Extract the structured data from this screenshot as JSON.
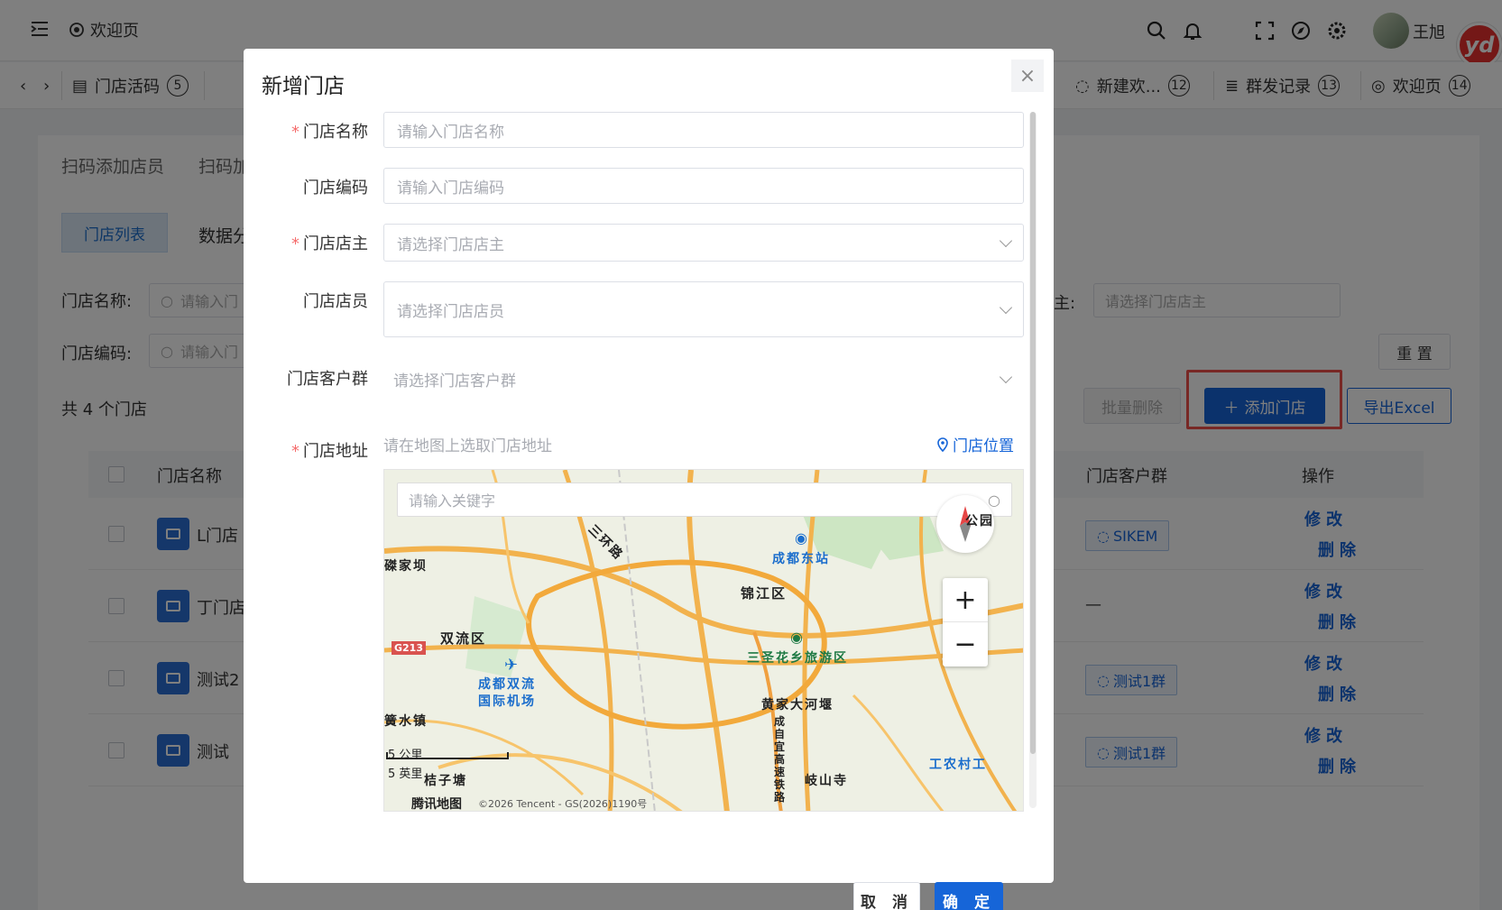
{
  "topbar": {
    "welcome_label": "欢迎页",
    "user_name": "王旭",
    "yd_badge": "yd"
  },
  "tabs": [
    {
      "label": "门店活码",
      "badge": "5"
    },
    {
      "label": "新建欢...",
      "badge": "12"
    },
    {
      "label": "群发记录",
      "badge": "13"
    },
    {
      "label": "欢迎页",
      "badge": "14"
    }
  ],
  "page": {
    "subtabs": [
      "扫码添加店员",
      "扫码加"
    ],
    "chips": [
      "门店列表",
      "数据分"
    ],
    "filters": {
      "store_name_label": "门店名称:",
      "store_name_placeholder": "请输入门",
      "store_code_label": "门店编码:",
      "store_code_placeholder": "请输入门",
      "owner_label": "主:",
      "owner_placeholder": "请选择门店店主"
    },
    "reset_label": "重 置",
    "count_label": "共 4 个门店",
    "batch_delete_label": "批量删除",
    "add_store_label": "添加门店",
    "export_label": "导出Excel",
    "columns": {
      "name": "门店名称",
      "group": "门店客户群",
      "ops": "操作"
    },
    "rows": [
      {
        "name": "L门店",
        "group": "SIKEM"
      },
      {
        "name": "丁门店",
        "group": "—"
      },
      {
        "name": "测试2",
        "group": "测试1群"
      },
      {
        "name": "测试",
        "group": "测试1群"
      }
    ],
    "edit_label": "修改",
    "delete_label": "删除"
  },
  "modal": {
    "title": "新增门店",
    "fields": {
      "name": {
        "label": "门店名称",
        "placeholder": "请输入门店名称"
      },
      "code": {
        "label": "门店编码",
        "placeholder": "请输入门店编码"
      },
      "owner": {
        "label": "门店店主",
        "placeholder": "请选择门店店主"
      },
      "staff": {
        "label": "门店店员",
        "placeholder": "请选择门店店员"
      },
      "groups": {
        "label": "门店客户群",
        "placeholder": "请选择门店客户群"
      },
      "address": {
        "label": "门店地址",
        "placeholder": "请在地图上选取门店地址",
        "locate_label": "门店位置"
      }
    },
    "map": {
      "search_placeholder": "请输入关键字",
      "labels": {
        "sanhuan": "三环路",
        "chengdu_east": "成都东站",
        "jinjiang": "锦江区",
        "shuangliu": "双流区",
        "airport1": "成都双流",
        "airport2": "国际机场",
        "sansheng": "三圣花乡旅游区",
        "huangjia": "黄家大河堰",
        "yongjiaba": "磔家坝",
        "shuizhen": "簧水镇",
        "nongcun": "工农村工",
        "qishan": "岐山寺",
        "taozi": "桔子塘",
        "expressway": "成自宜高速铁路",
        "shield": "G213",
        "gong": "公园"
      },
      "scale_km": "5 公里",
      "scale_mi": "5 英里",
      "copyright": "©2026 Tencent - GS(2026)1190号",
      "brand": "腾讯地图"
    },
    "cancel_label": "取 消",
    "confirm_label": "确 定"
  },
  "colors": {
    "primary": "#1665d8",
    "highlight": "#f0504b",
    "required": "#f56c6c"
  }
}
